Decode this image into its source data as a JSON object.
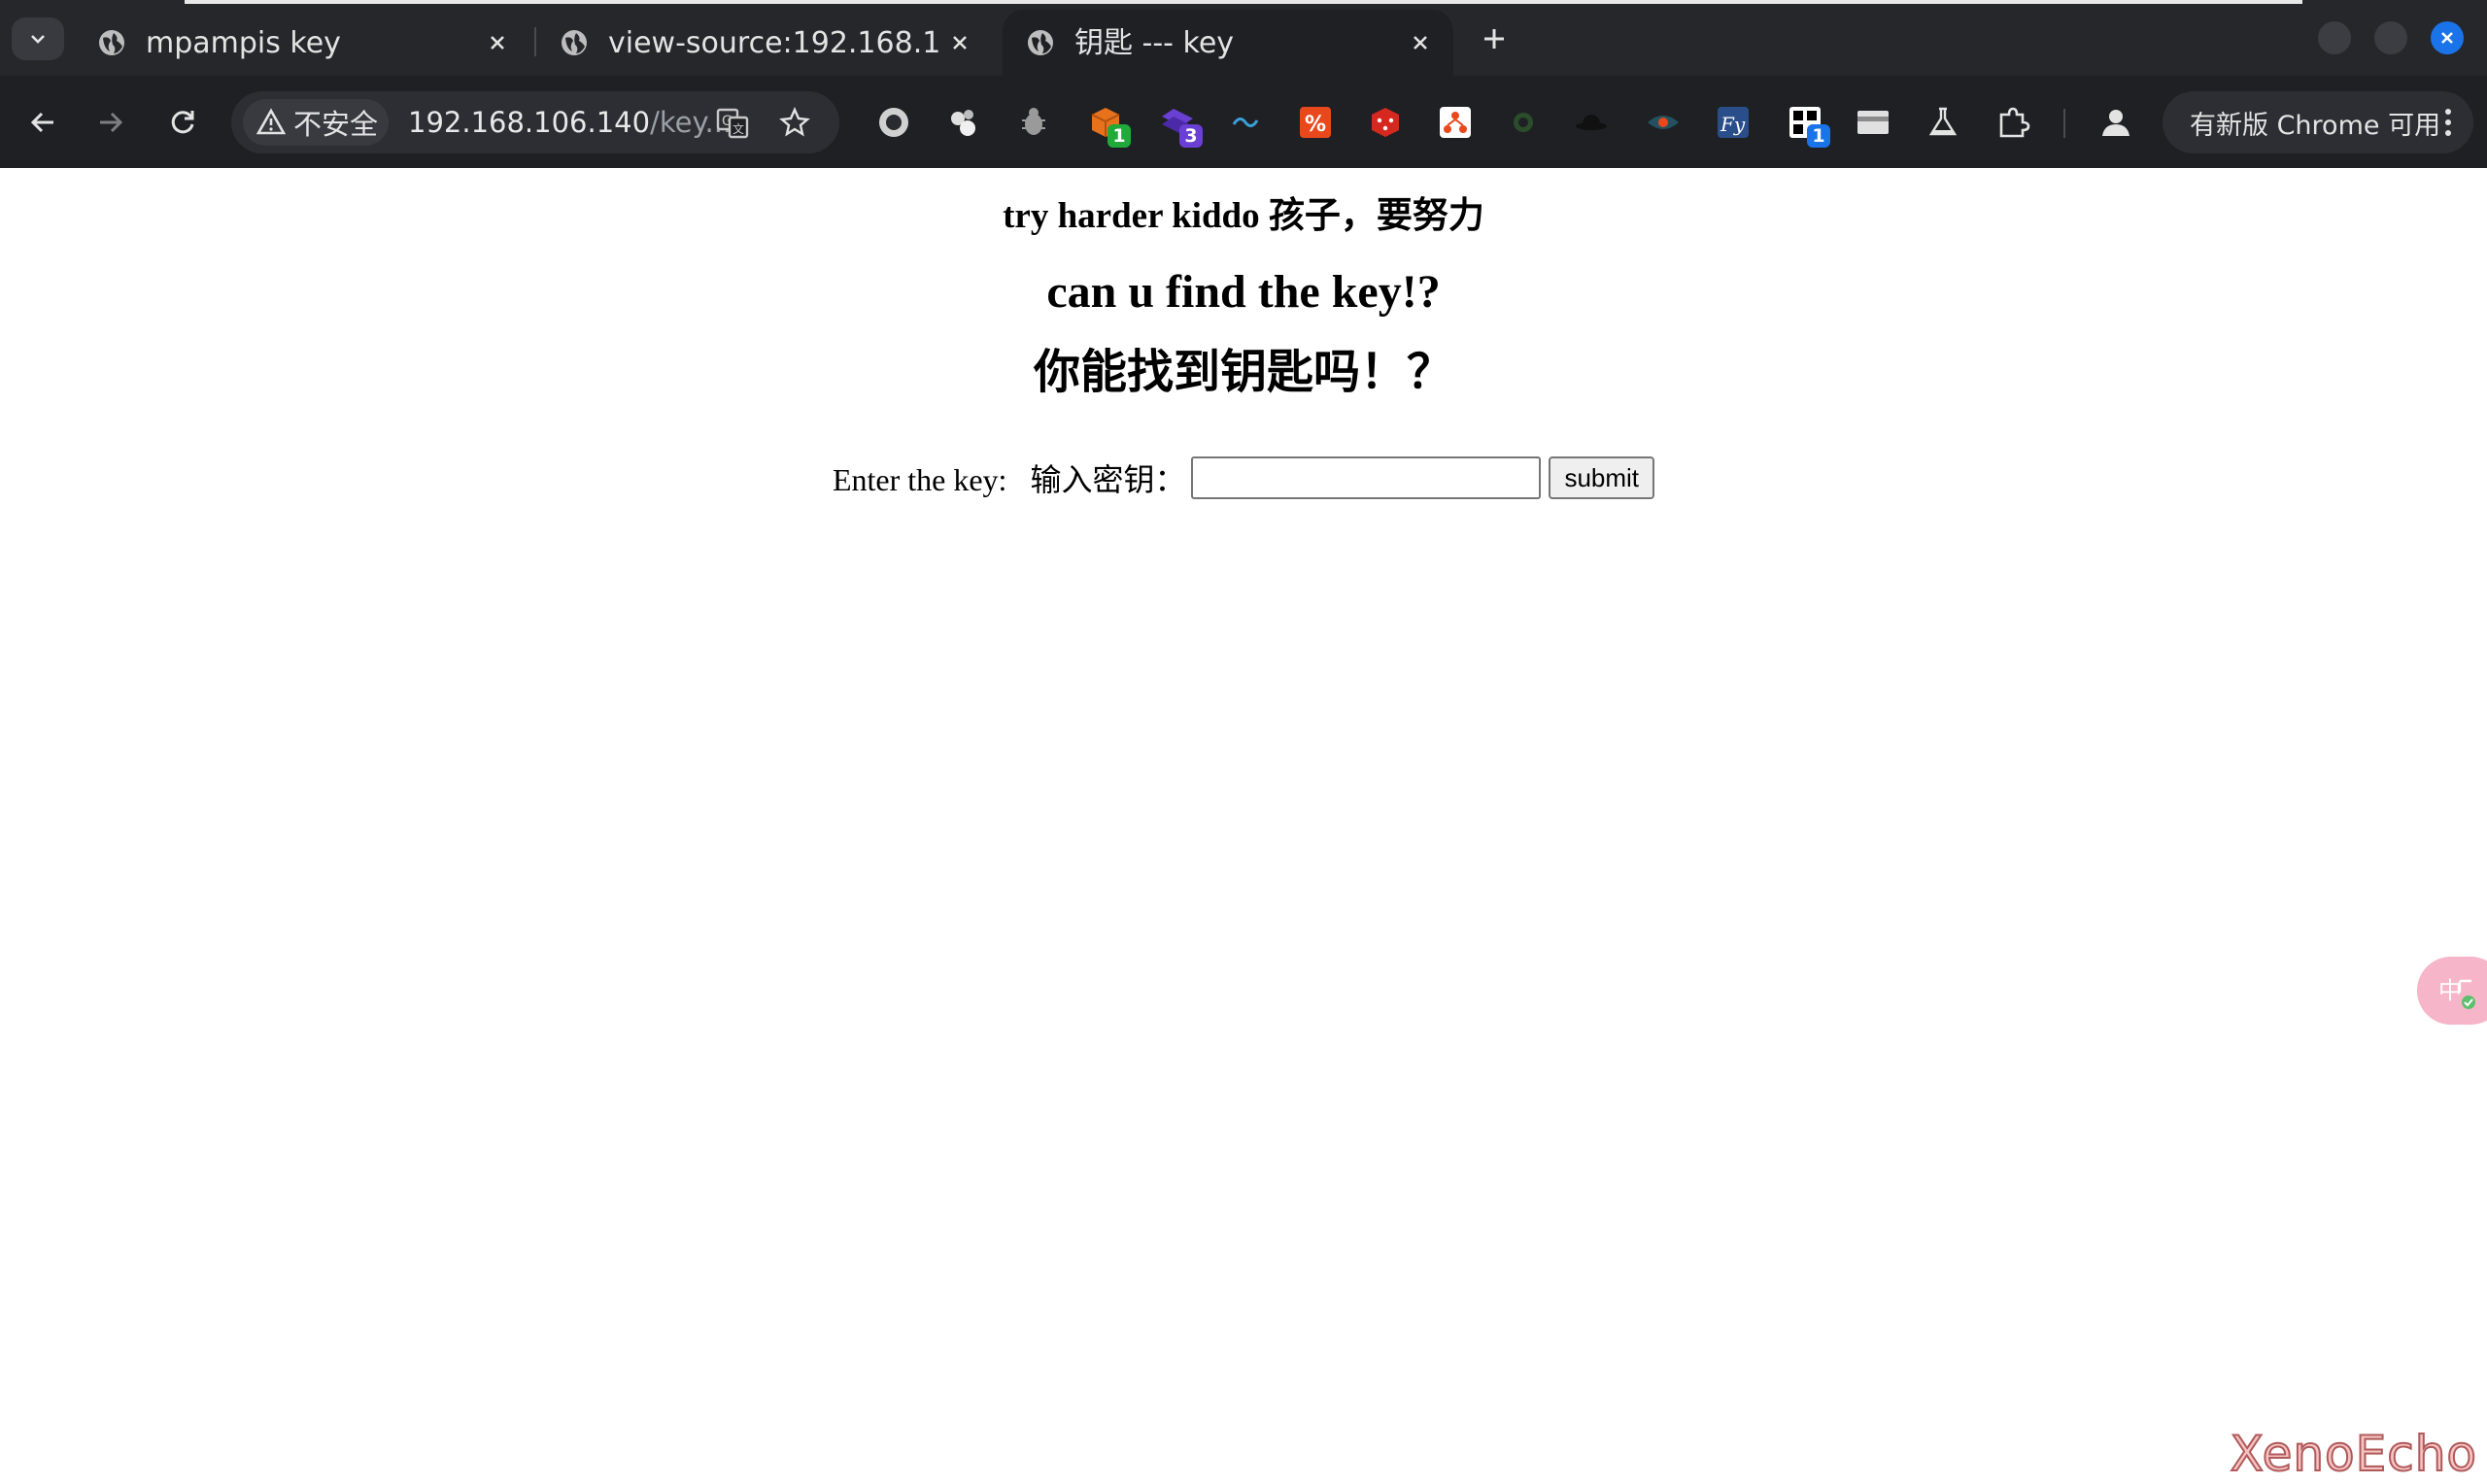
{
  "browser": {
    "tabs": [
      {
        "title": "mpampis key",
        "active": false
      },
      {
        "title": "view-source:192.168.106",
        "active": false
      },
      {
        "title": "钥匙 --- key",
        "active": true
      }
    ],
    "security_label": "不安全",
    "url_host": "192.168.106.140",
    "url_rest": "/key....",
    "extension_badges": {
      "ext_green": "1",
      "ext_purple": "3",
      "ext_qr": "1"
    },
    "update_label": "有新版 Chrome 可用"
  },
  "page": {
    "try_harder": "try harder kiddo  孩子，要努力",
    "heading_en": "can u find the key!?",
    "heading_cn": "你能找到钥匙吗！？",
    "key_label": "Enter the key:   输入密钥：",
    "key_value": "",
    "submit_label": "submit"
  },
  "watermark": "XenoEcho"
}
